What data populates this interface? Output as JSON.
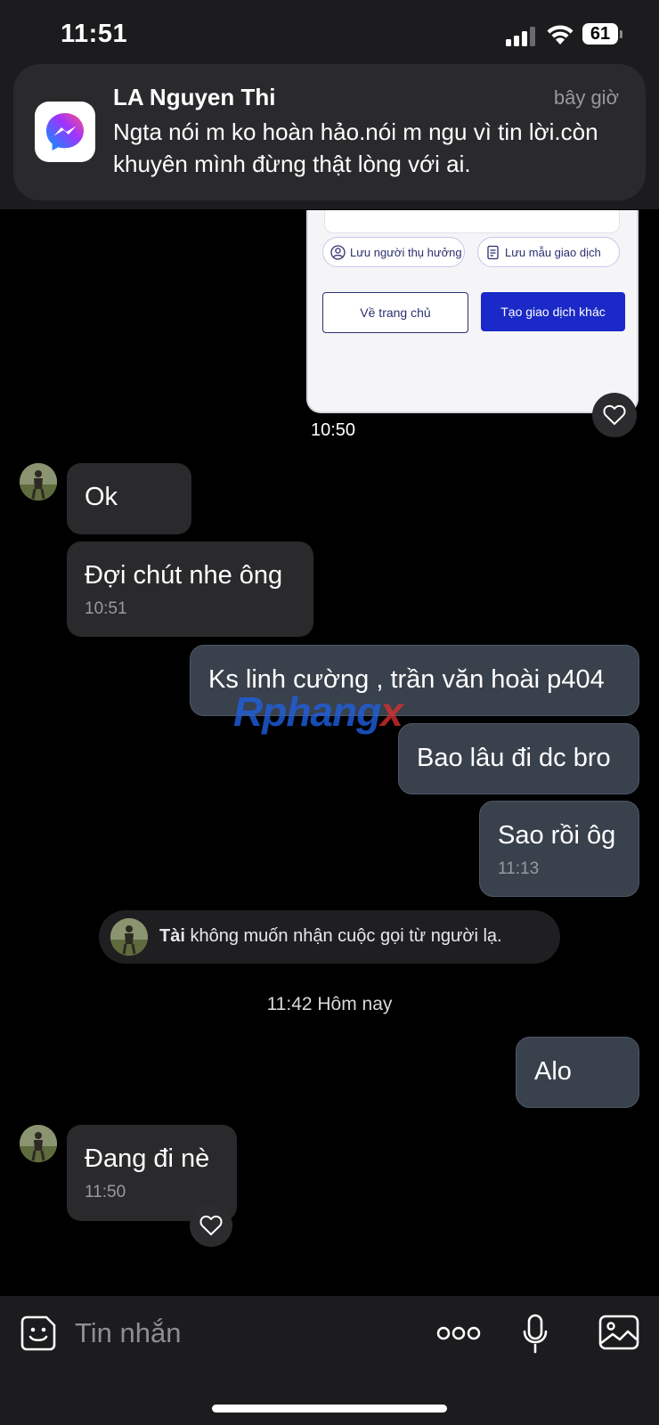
{
  "status_bar": {
    "time": "11:51",
    "battery": "61"
  },
  "notification": {
    "sender": "LA Nguyen Thi",
    "time": "bây giờ",
    "body": "Ngta nói m ko hoàn hảo.nói m ngu vì tin lời.còn khuyên mình đừng thật lòng với ai."
  },
  "shared_card": {
    "save_beneficiary": "Lưu người thụ hưởng",
    "save_template": "Lưu mẫu giao dịch",
    "home_button": "Về trang chủ",
    "new_transaction_button": "Tạo giao dịch khác",
    "time": "10:50"
  },
  "messages": [
    {
      "direction": "in",
      "text": "Ok"
    },
    {
      "direction": "in",
      "text": "Đợi chút nhe ông",
      "time": "10:51"
    },
    {
      "direction": "out",
      "text": "Ks linh cường , trần văn hoài p404"
    },
    {
      "direction": "out",
      "text": "Bao lâu đi dc bro"
    },
    {
      "direction": "out",
      "text": "Sao rồi ôg",
      "time": "11:13"
    },
    {
      "direction": "out",
      "text": "Alo"
    },
    {
      "direction": "in",
      "text": "Đang đi nè",
      "time": "11:50"
    }
  ],
  "system_message": {
    "name": "Tài",
    "text": "không muốn nhận cuộc gọi từ người lạ."
  },
  "date_separator": "11:42 Hôm nay",
  "watermark": {
    "part1": "Rphang",
    "part2": "x"
  },
  "composer": {
    "placeholder": "Tin nhắn"
  },
  "colors": {
    "background": "#000000",
    "incoming_bubble": "#2a2a2c",
    "outgoing_bubble": "#39414c",
    "card_primary": "#1a29c7",
    "messenger_gradient": [
      "#0099ff",
      "#a033ff",
      "#ff5280"
    ]
  },
  "icons": [
    "messenger-icon",
    "heart-icon",
    "sticker-icon",
    "more-icon",
    "microphone-icon",
    "gallery-icon",
    "person-icon",
    "document-icon"
  ]
}
